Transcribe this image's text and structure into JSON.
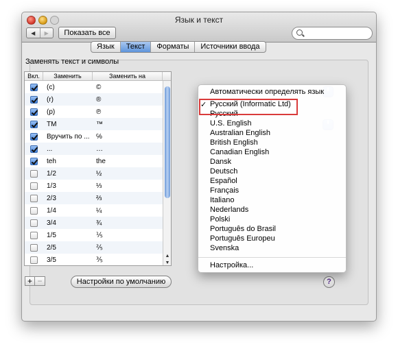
{
  "window": {
    "title": "Язык и текст"
  },
  "toolbar": {
    "back_glyph": "◀",
    "forward_glyph": "▶",
    "show_all_label": "Показать все",
    "search_placeholder": "",
    "search_icon": "magnifier-icon"
  },
  "tabs": [
    {
      "label": "Язык",
      "active": false
    },
    {
      "label": "Текст",
      "active": true
    },
    {
      "label": "Форматы",
      "active": false
    },
    {
      "label": "Источники ввода",
      "active": false
    }
  ],
  "replace": {
    "section_label": "Заменять текст и символы",
    "columns": [
      "Вкл.",
      "Заменить",
      "Заменить на"
    ],
    "rows": [
      {
        "on": true,
        "replace": "(c)",
        "with": "©"
      },
      {
        "on": true,
        "replace": "(r)",
        "with": "®"
      },
      {
        "on": true,
        "replace": "(p)",
        "with": "℗"
      },
      {
        "on": true,
        "replace": "TM",
        "with": "™"
      },
      {
        "on": true,
        "replace": "Вручить по ...",
        "with": "℅"
      },
      {
        "on": true,
        "replace": "...",
        "with": "…"
      },
      {
        "on": true,
        "replace": "teh",
        "with": "the"
      },
      {
        "on": false,
        "replace": "1/2",
        "with": "½"
      },
      {
        "on": false,
        "replace": "1/3",
        "with": "⅓"
      },
      {
        "on": false,
        "replace": "2/3",
        "with": "⅔"
      },
      {
        "on": false,
        "replace": "1/4",
        "with": "¼"
      },
      {
        "on": false,
        "replace": "3/4",
        "with": "¾"
      },
      {
        "on": false,
        "replace": "1/5",
        "with": "⅕"
      },
      {
        "on": false,
        "replace": "2/5",
        "with": "⅖"
      },
      {
        "on": false,
        "replace": "3/5",
        "with": "⅗"
      }
    ],
    "scroll_up_glyph": "▲",
    "scroll_down_glyph": "▼"
  },
  "bottom": {
    "add_glyph": "+",
    "remove_glyph": "−",
    "defaults_label": "Настройки по умолчанию",
    "help_glyph": "?"
  },
  "popup_glyph": "⬍",
  "menu": {
    "items": [
      {
        "label": "Автоматически определять язык",
        "checked": false
      },
      {
        "label": "Русский (Informatic Ltd)",
        "checked": true
      },
      {
        "label": "Русский",
        "checked": false
      },
      {
        "label": "U.S. English",
        "checked": false
      },
      {
        "label": "Australian English",
        "checked": false
      },
      {
        "label": "British English",
        "checked": false
      },
      {
        "label": "Canadian English",
        "checked": false
      },
      {
        "label": "Dansk",
        "checked": false
      },
      {
        "label": "Deutsch",
        "checked": false
      },
      {
        "label": "Español",
        "checked": false
      },
      {
        "label": "Français",
        "checked": false
      },
      {
        "label": "Italiano",
        "checked": false
      },
      {
        "label": "Nederlands",
        "checked": false
      },
      {
        "label": "Polski",
        "checked": false
      },
      {
        "label": "Português do Brasil",
        "checked": false
      },
      {
        "label": "Português Europeu",
        "checked": false
      },
      {
        "label": "Svenska",
        "checked": false
      },
      {
        "label": "Настройка...",
        "checked": false
      }
    ],
    "highlight_color": "#d93a3a"
  },
  "colors": {
    "accent": "#5f95dc",
    "checkbox_on": "#3f7fd9"
  }
}
